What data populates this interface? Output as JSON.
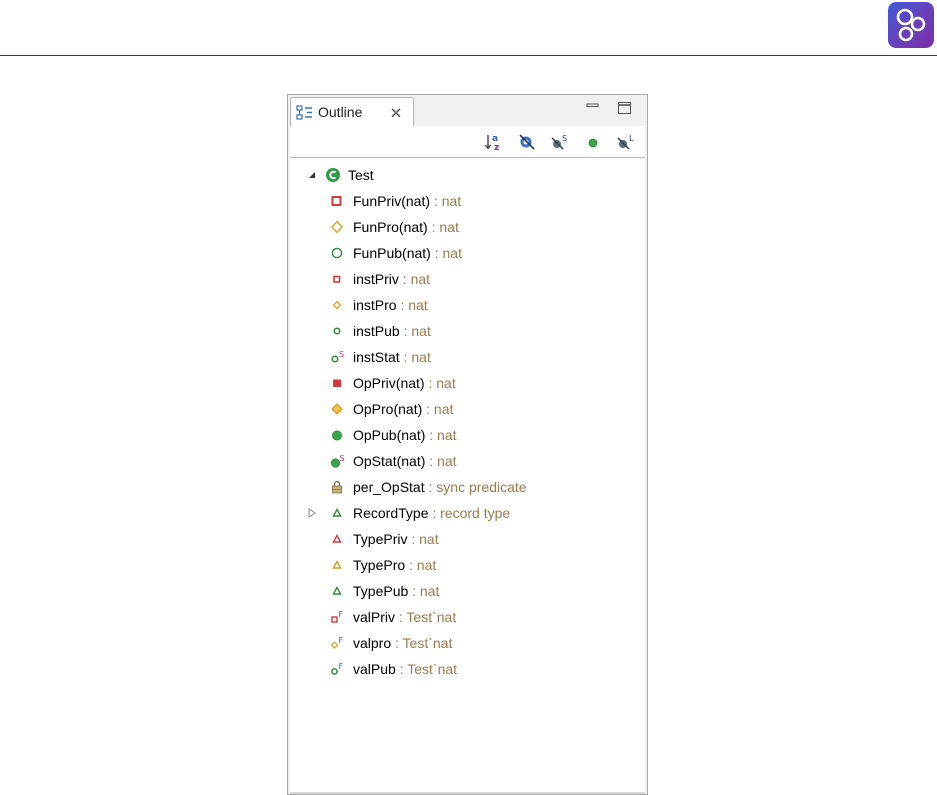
{
  "outline": {
    "tab_title": "Outline",
    "root": {
      "name": "Test",
      "expanded": true
    },
    "items": [
      {
        "name": "FunPriv(nat)",
        "type": " : nat",
        "icon": "private-function-icon",
        "color": "#d43a3a"
      },
      {
        "name": "FunPro(nat)",
        "type": " : nat",
        "icon": "protected-function-icon",
        "color": "#e0a21c"
      },
      {
        "name": "FunPub(nat)",
        "type": " : nat",
        "icon": "public-function-icon",
        "color": "#2e8b3d"
      },
      {
        "name": "instPriv",
        "type": " : nat",
        "icon": "private-instance-variable-icon",
        "color": "#d43a3a"
      },
      {
        "name": "instPro",
        "type": " : nat",
        "icon": "protected-instance-variable-icon",
        "color": "#e0a21c"
      },
      {
        "name": "instPub",
        "type": " : nat",
        "icon": "public-instance-variable-icon",
        "color": "#2e8b3d"
      },
      {
        "name": "instStat",
        "type": " : nat",
        "icon": "static-instance-variable-icon",
        "color": "#2e8b3d"
      },
      {
        "name": "OpPriv(nat)",
        "type": " : nat",
        "icon": "private-operation-icon",
        "color": "#d43a3a"
      },
      {
        "name": "OpPro(nat)",
        "type": " : nat",
        "icon": "protected-operation-icon",
        "color": "#e0a21c"
      },
      {
        "name": "OpPub(nat)",
        "type": " : nat",
        "icon": "public-operation-icon",
        "color": "#2e8b3d"
      },
      {
        "name": "OpStat(nat)",
        "type": " : nat",
        "icon": "static-operation-icon",
        "color": "#2e8b3d"
      },
      {
        "name": "per_OpStat",
        "type": " : sync predicate",
        "icon": "lock-icon",
        "color": "#8a7a3a"
      },
      {
        "name": "RecordType",
        "type": " : record type",
        "icon": "public-type-icon",
        "color": "#2e8b3d",
        "collapsed": true
      },
      {
        "name": "TypePriv",
        "type": " : nat",
        "icon": "private-type-icon",
        "color": "#d43a3a"
      },
      {
        "name": "TypePro",
        "type": " : nat",
        "icon": "protected-type-icon",
        "color": "#c9a21c"
      },
      {
        "name": "TypePub",
        "type": " : nat",
        "icon": "public-type-icon",
        "color": "#2e8b3d"
      },
      {
        "name": "valPriv",
        "type": " : Test`nat",
        "icon": "private-value-icon",
        "color": "#d43a3a"
      },
      {
        "name": "valpro",
        "type": " : Test`nat",
        "icon": "protected-value-icon",
        "color": "#e0a21c"
      },
      {
        "name": "valPub",
        "type": " : Test`nat",
        "icon": "public-value-icon",
        "color": "#2e8b3d"
      }
    ]
  },
  "toolbar_icons": [
    "sort-alphabetically-icon",
    "hide-fields-icon",
    "hide-static-members-icon",
    "hide-non-public-members-icon",
    "hide-local-types-icon"
  ],
  "colors": {
    "type_text": "#9a7b4e",
    "private": "#d43a3a",
    "protected": "#e0a21c",
    "public": "#2e8b3d"
  }
}
